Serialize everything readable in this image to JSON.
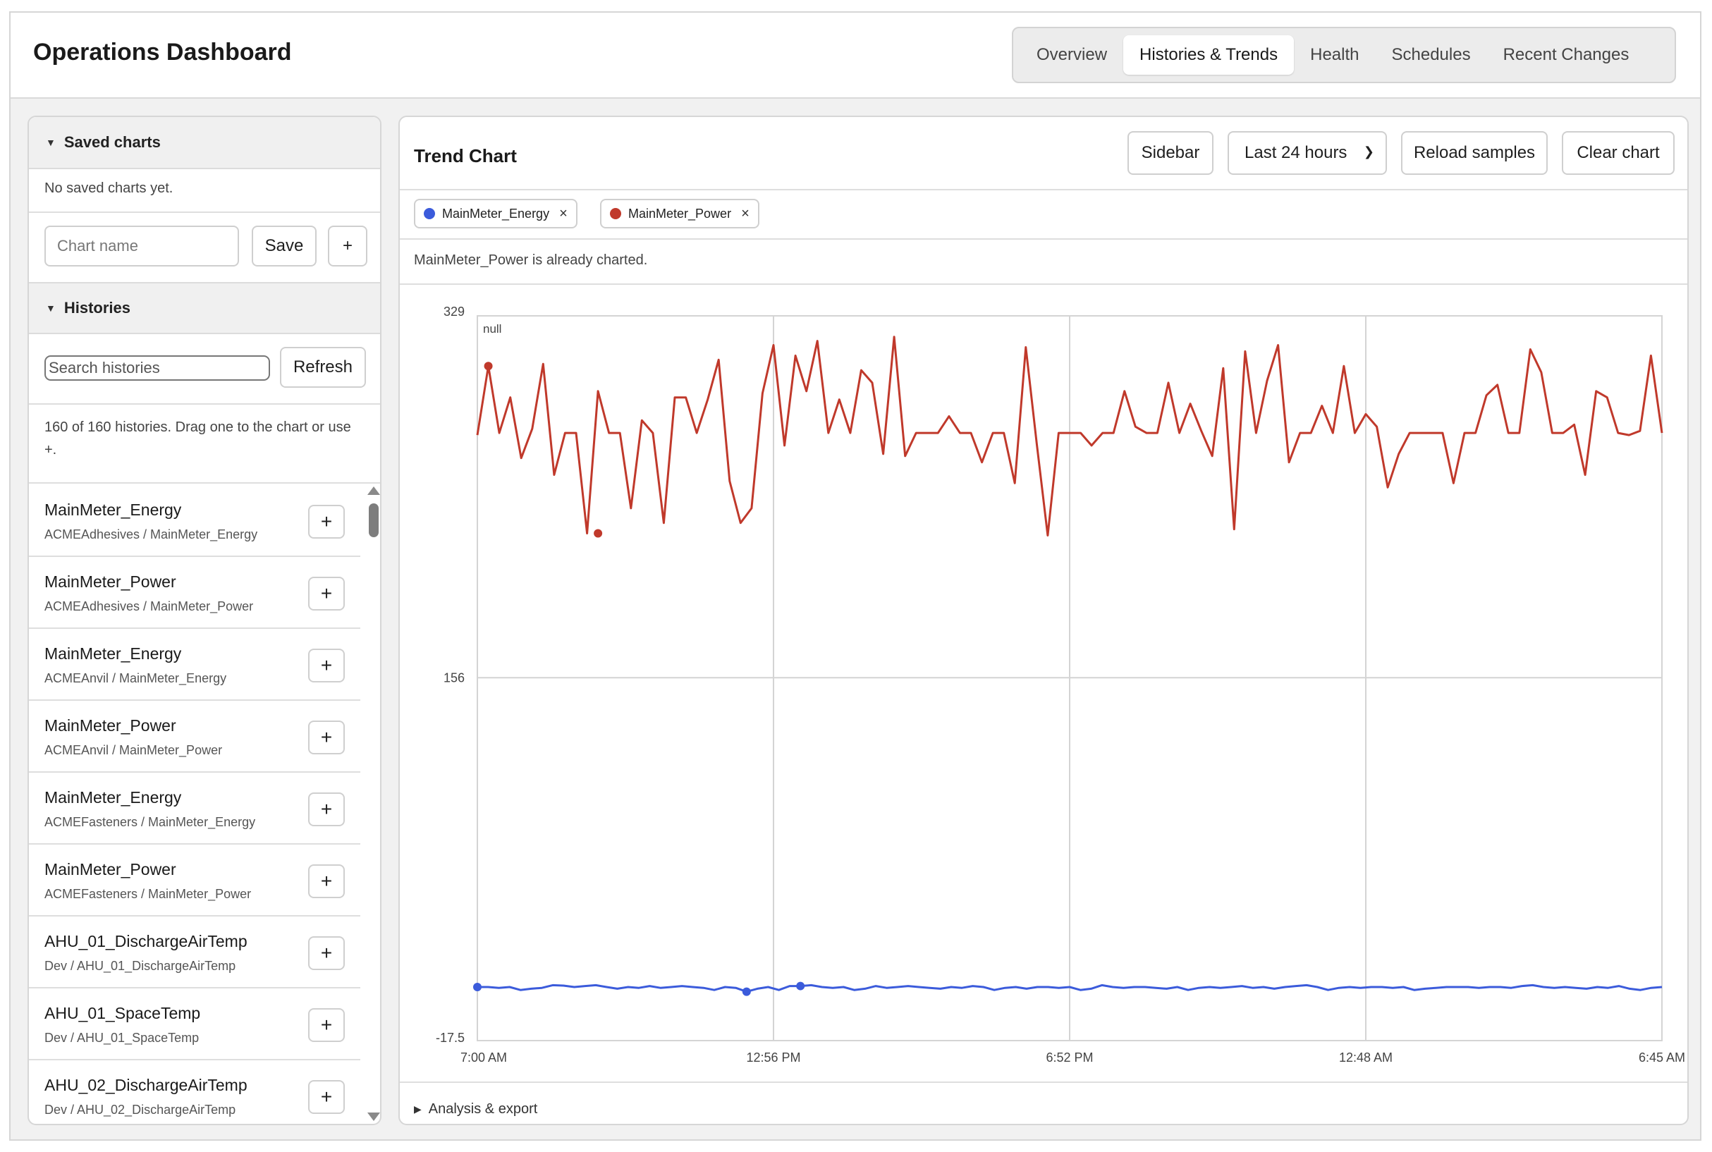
{
  "header": {
    "title": "Operations Dashboard",
    "tabs": [
      {
        "label": "Overview",
        "active": false
      },
      {
        "label": "Histories & Trends",
        "active": true
      },
      {
        "label": "Health",
        "active": false
      },
      {
        "label": "Schedules",
        "active": false
      },
      {
        "label": "Recent Changes",
        "active": false
      }
    ]
  },
  "sidebar": {
    "saved_charts": {
      "title": "Saved charts",
      "empty_text": "No saved charts yet.",
      "name_placeholder": "Chart name",
      "save_label": "Save",
      "add_label": "+"
    },
    "histories": {
      "title": "Histories",
      "search_placeholder": "Search histories",
      "refresh_label": "Refresh",
      "count_text": "160 of 160 histories. Drag one to the chart or use +.",
      "items": [
        {
          "name": "MainMeter_Energy",
          "path": "ACMEAdhesives / MainMeter_Energy"
        },
        {
          "name": "MainMeter_Power",
          "path": "ACMEAdhesives / MainMeter_Power"
        },
        {
          "name": "MainMeter_Energy",
          "path": "ACMEAnvil / MainMeter_Energy"
        },
        {
          "name": "MainMeter_Power",
          "path": "ACMEAnvil / MainMeter_Power"
        },
        {
          "name": "MainMeter_Energy",
          "path": "ACMEFasteners / MainMeter_Energy"
        },
        {
          "name": "MainMeter_Power",
          "path": "ACMEFasteners / MainMeter_Power"
        },
        {
          "name": "AHU_01_DischargeAirTemp",
          "path": "Dev / AHU_01_DischargeAirTemp"
        },
        {
          "name": "AHU_01_SpaceTemp",
          "path": "Dev / AHU_01_SpaceTemp"
        },
        {
          "name": "AHU_02_DischargeAirTemp",
          "path": "Dev / AHU_02_DischargeAirTemp"
        }
      ],
      "add_item_label": "+"
    }
  },
  "main": {
    "title": "Trend Chart",
    "sidebar_button": "Sidebar",
    "range_select": "Last 24 hours",
    "reload_button": "Reload samples",
    "clear_button": "Clear chart",
    "notice": "MainMeter_Power is already charted.",
    "analysis_label": "Analysis & export",
    "chip_close": "×"
  },
  "chart_data": {
    "type": "line",
    "title": "",
    "annotation": "null",
    "ylim": [
      -17.5,
      329
    ],
    "yticks": [
      "329",
      "156",
      "-17.5"
    ],
    "xticks": [
      "7:00 AM",
      "12:56 PM",
      "6:52 PM",
      "12:48 AM",
      "6:45 AM"
    ],
    "grid": true,
    "series": [
      {
        "name": "MainMeter_Energy",
        "color": "#3b5bdb",
        "values": [
          8.1,
          8.1,
          7.7,
          8.1,
          6.7,
          7.3,
          7.7,
          9.0,
          8.8,
          8.1,
          8.6,
          9.0,
          8.1,
          7.3,
          8.1,
          7.7,
          8.6,
          7.7,
          8.1,
          8.6,
          8.1,
          7.7,
          6.7,
          8.1,
          7.7,
          5.9,
          7.3,
          8.1,
          6.7,
          8.6,
          8.6,
          9.0,
          8.1,
          7.7,
          8.1,
          6.7,
          7.3,
          8.6,
          7.7,
          8.1,
          8.6,
          8.1,
          7.7,
          7.3,
          8.1,
          7.7,
          8.6,
          8.1,
          6.7,
          7.7,
          8.1,
          7.3,
          8.1,
          8.1,
          7.7,
          8.1,
          6.7,
          7.3,
          9.0,
          8.1,
          7.7,
          8.1,
          8.1,
          7.7,
          7.3,
          8.1,
          6.7,
          7.7,
          8.1,
          7.7,
          8.1,
          8.6,
          7.7,
          8.1,
          7.3,
          8.1,
          8.6,
          9.0,
          8.1,
          6.7,
          7.7,
          8.1,
          7.7,
          8.1,
          8.1,
          7.7,
          8.1,
          6.7,
          7.3,
          7.7,
          8.1,
          8.1,
          8.1,
          7.7,
          8.1,
          8.1,
          7.7,
          8.6,
          9.0,
          8.1,
          7.7,
          8.1,
          7.7,
          7.3,
          8.1,
          7.7,
          8.6,
          7.3,
          6.7,
          7.7,
          8.1
        ],
        "highlight": [
          [
            0,
            8.1
          ],
          [
            25,
            5.9
          ],
          [
            30,
            8.6
          ]
        ]
      },
      {
        "name": "MainMeter_Power",
        "color": "#c0392b",
        "values": [
          272,
          305,
          273,
          290,
          261,
          275,
          306,
          253,
          273,
          273,
          225,
          293,
          273,
          273,
          237,
          279,
          273,
          230,
          290,
          290,
          273,
          289,
          308,
          250,
          230,
          237,
          292,
          315,
          267,
          310,
          293,
          317,
          273,
          289,
          273,
          303,
          297,
          263,
          319,
          262,
          273,
          273,
          273,
          281,
          273,
          273,
          259,
          273,
          273,
          249,
          314,
          268,
          224,
          273,
          273,
          273,
          267,
          273,
          273,
          293,
          276,
          273,
          273,
          297,
          273,
          287,
          274,
          262,
          304,
          227,
          312,
          273,
          298,
          315,
          259,
          273,
          273,
          286,
          273,
          305,
          273,
          282,
          276,
          247,
          263,
          273,
          273,
          273,
          273,
          249,
          273,
          273,
          291,
          296,
          273,
          273,
          313,
          302,
          273,
          273,
          277,
          253,
          293,
          290,
          273,
          272,
          274,
          310,
          273
        ],
        "highlight": [
          [
            1,
            305
          ],
          [
            11,
            225
          ]
        ]
      }
    ]
  }
}
